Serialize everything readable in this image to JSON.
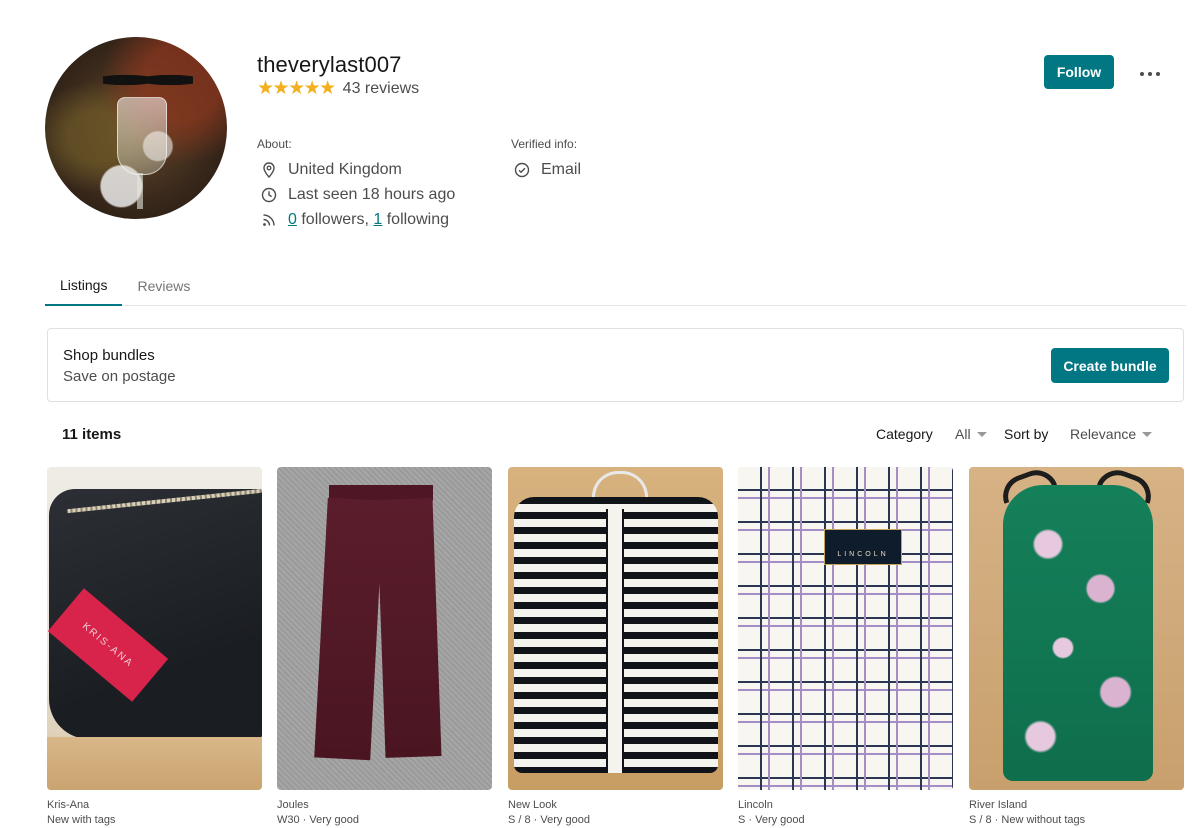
{
  "profile": {
    "username": "theverylast007",
    "stars": "★★★★★",
    "reviews_text": "43 reviews",
    "about_label": "About:",
    "location": "United Kingdom",
    "last_seen": "Last seen 18 hours ago",
    "followers_count": "0",
    "followers_text": " followers, ",
    "following_count": "1",
    "following_text": " following",
    "verified_label": "Verified info:",
    "verified_email": "Email",
    "follow_label": "Follow"
  },
  "tabs": [
    {
      "label": "Listings",
      "active": true
    },
    {
      "label": "Reviews",
      "active": false
    }
  ],
  "bundles": {
    "title": "Shop bundles",
    "subtitle": "Save on postage",
    "button_label": "Create bundle"
  },
  "listing_bar": {
    "items_count": "11 items",
    "category_label": "Category",
    "category_value": "All",
    "sort_label": "Sort by",
    "sort_value": "Relevance"
  },
  "items": [
    {
      "brand": "Kris-Ana",
      "meta": "New with tags",
      "tag_text": "KRIS-ANA"
    },
    {
      "brand": "Joules",
      "meta": "W30 · Very good"
    },
    {
      "brand": "New Look",
      "meta": "S / 8 · Very good"
    },
    {
      "brand": "Lincoln",
      "meta": "S · Very good",
      "label_text": "LINCOLN"
    },
    {
      "brand": "River Island",
      "meta": "S / 8 · New without tags"
    }
  ],
  "colors": {
    "accent": "#007782",
    "star": "#f2b01e",
    "text_primary": "#171717",
    "text_secondary": "#4d4d4d"
  }
}
